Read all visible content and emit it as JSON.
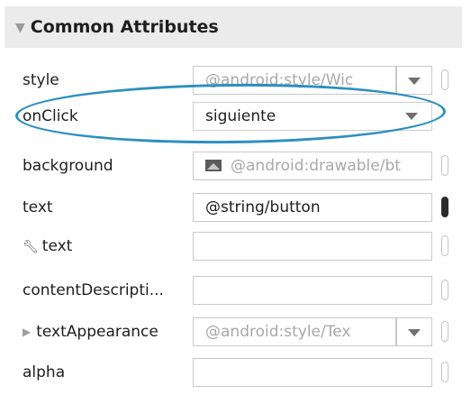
{
  "section": {
    "title": "Common Attributes"
  },
  "attributes": [
    {
      "label": "style",
      "value": "@android:style/Wic"
    },
    {
      "label": "onClick",
      "value": "siguiente"
    },
    {
      "label": "background",
      "value": "@android:drawable/bt"
    },
    {
      "label": "text",
      "value": "@string/button"
    },
    {
      "label": "text",
      "value": ""
    },
    {
      "label": "contentDescripti...",
      "value": ""
    },
    {
      "label": "textAppearance",
      "value": "@android:style/Tex"
    },
    {
      "label": "alpha",
      "value": ""
    }
  ],
  "colors": {
    "header_bg": "#ebebeb",
    "highlight": "#2d8fc0"
  },
  "icons": {
    "section_toggle": "triangle-down-icon",
    "tools_text": "wrench-icon",
    "expand": "triangle-right-icon",
    "drawable": "image-icon",
    "dropdown": "chevron-down-icon"
  }
}
